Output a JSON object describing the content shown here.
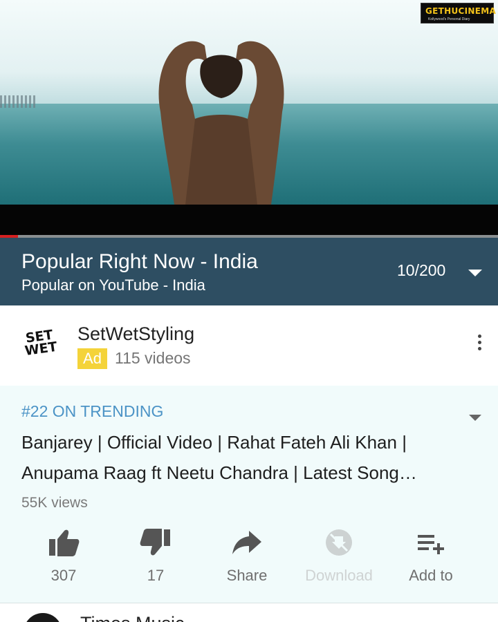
{
  "watermark": {
    "text": "GETHUCINEMA",
    "subtext": "Kollywood's Personal Diary"
  },
  "player": {
    "progress_fraction": 0.036
  },
  "playlist": {
    "title": "Popular Right Now - India",
    "subtitle": "Popular on YouTube - India",
    "position": "10/200"
  },
  "channel": {
    "logo_text": "SET WET",
    "name": "SetWetStyling",
    "ad_label": "Ad",
    "video_count": "115 videos"
  },
  "video": {
    "trending": "#22 ON TRENDING",
    "title": "Banjarey | Official Video | Rahat Fateh Ali Khan | Anupama Raag ft Neetu Chandra | Latest Song…",
    "views": "55K views"
  },
  "actions": {
    "like": {
      "label": "307",
      "icon": "thumbs-up-icon"
    },
    "dislike": {
      "label": "17",
      "icon": "thumbs-down-icon"
    },
    "share": {
      "label": "Share",
      "icon": "share-icon"
    },
    "download": {
      "label": "Download",
      "icon": "download-disabled-icon"
    },
    "add_to": {
      "label": "Add to",
      "icon": "playlist-add-icon"
    }
  },
  "next_channel": {
    "name": "Times Music"
  },
  "colors": {
    "accent_blue": "#4b93c6",
    "playlist_bar": "#2e4e62",
    "ad_yellow": "#f4d33a",
    "progress_red": "#d52021"
  }
}
